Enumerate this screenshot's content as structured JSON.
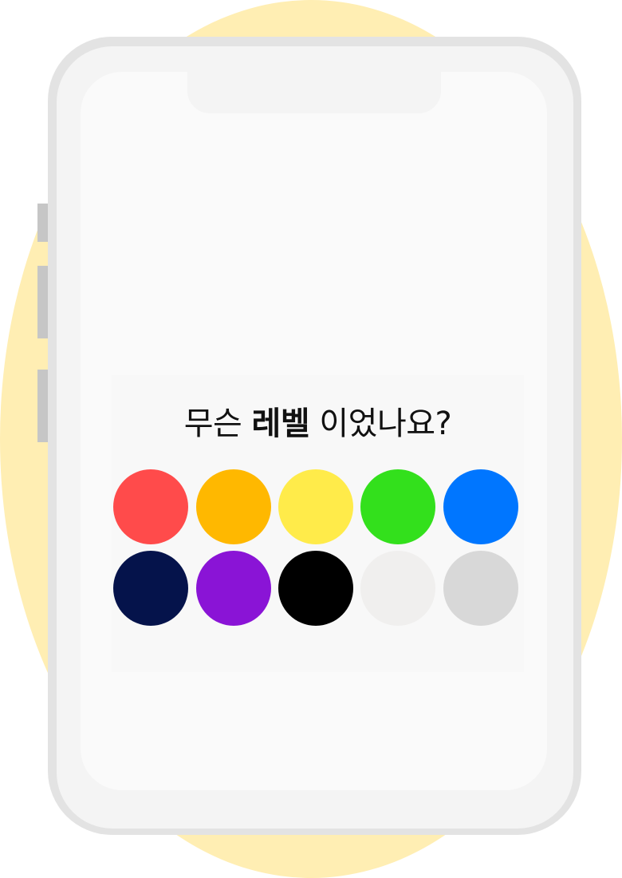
{
  "question": {
    "prefix": "무슨",
    "emphasis": "레벨",
    "suffix": "이었나요?"
  },
  "colors": [
    {
      "name": "red",
      "hex": "#ff4b4b"
    },
    {
      "name": "orange",
      "hex": "#ffb800"
    },
    {
      "name": "yellow",
      "hex": "#ffeb4a"
    },
    {
      "name": "green",
      "hex": "#33e01c"
    },
    {
      "name": "blue",
      "hex": "#0076ff"
    },
    {
      "name": "navy",
      "hex": "#05134b"
    },
    {
      "name": "purple",
      "hex": "#8a14d6"
    },
    {
      "name": "black",
      "hex": "#000000"
    },
    {
      "name": "white",
      "hex": "#f0efee"
    },
    {
      "name": "gray",
      "hex": "#d8d8d8"
    }
  ],
  "icons": {
    "phone": "phone-frame-illustration"
  }
}
